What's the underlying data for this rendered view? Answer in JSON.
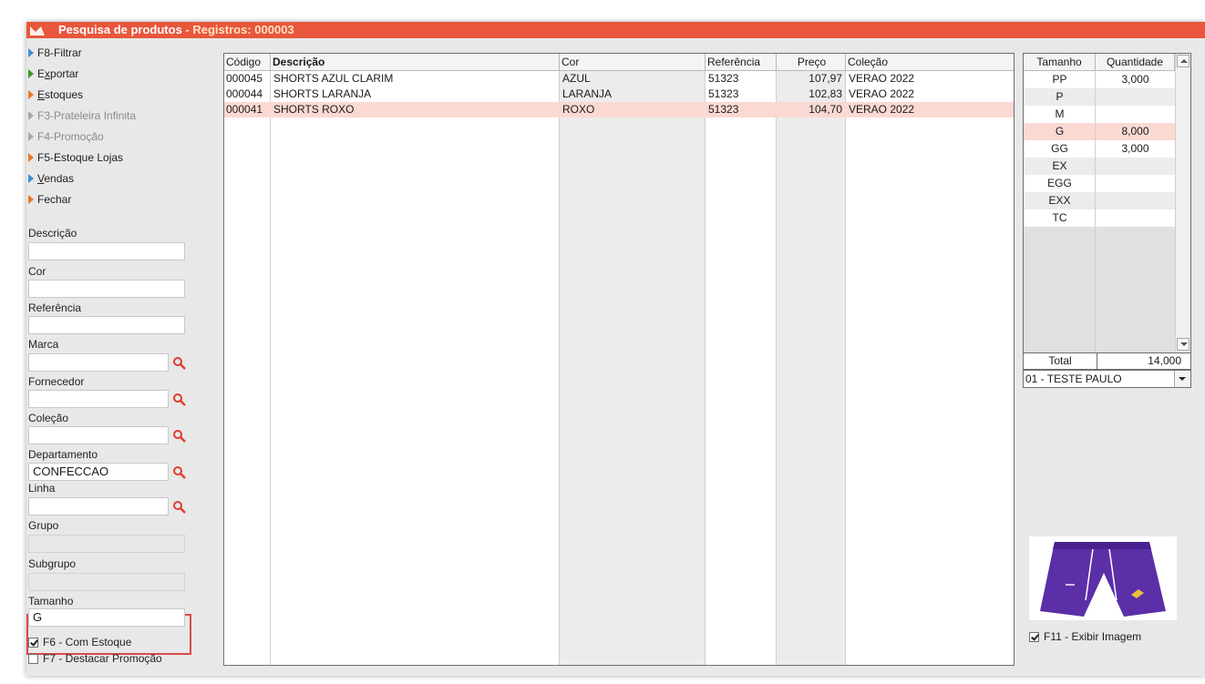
{
  "title": {
    "name": "Pesquisa de produtos",
    "separator": " - ",
    "records": "Registros: 000003"
  },
  "menu": [
    {
      "key": "",
      "label": "F8-Filtrar",
      "color": "blue",
      "enabled": true
    },
    {
      "key": "E",
      "label": "xportar",
      "color": "green",
      "enabled": true,
      "underline_index": 1
    },
    {
      "key": "E",
      "label": "stoques",
      "color": "orange",
      "enabled": true
    },
    {
      "key": "",
      "label": "F3-Prateleira Infinita",
      "color": "grey",
      "enabled": false
    },
    {
      "key": "",
      "label": "F4-Promoção",
      "color": "grey",
      "enabled": false
    },
    {
      "key": "",
      "label": "F5-Estoque Lojas",
      "color": "orange",
      "enabled": true
    },
    {
      "key": "V",
      "label": "endas",
      "color": "blue",
      "enabled": true
    },
    {
      "key": "",
      "label": "Fechar",
      "color": "orange",
      "enabled": true
    }
  ],
  "filters": {
    "descricao": {
      "label": "Descrição",
      "value": ""
    },
    "cor": {
      "label": "Cor",
      "value": ""
    },
    "referencia": {
      "label": "Referência",
      "value": ""
    },
    "marca": {
      "label": "Marca",
      "value": ""
    },
    "fornecedor": {
      "label": "Fornecedor",
      "value": ""
    },
    "colecao": {
      "label": "Coleção",
      "value": ""
    },
    "departamento": {
      "label": "Departamento",
      "value": "CONFECCAO"
    },
    "linha": {
      "label": "Linha",
      "value": ""
    },
    "grupo": {
      "label": "Grupo",
      "value": ""
    },
    "subgrupo": {
      "label": "Subgrupo",
      "value": ""
    },
    "tamanho": {
      "label": "Tamanho",
      "value": "G"
    }
  },
  "checks": {
    "com_estoque": {
      "label": "F6 - Com Estoque",
      "checked": true
    },
    "destacar_promocao": {
      "label": "F7 - Destacar Promoção",
      "checked": false
    }
  },
  "grid": {
    "columns": [
      "Código",
      "Descrição",
      "Cor",
      "Referência",
      "Preço",
      "Coleção"
    ],
    "rows": [
      {
        "codigo": "000045",
        "descricao": "SHORTS AZUL CLARIM",
        "cor": "AZUL",
        "referencia": "51323",
        "preco": "107,97",
        "colecao": "VERAO 2022",
        "selected": false
      },
      {
        "codigo": "000044",
        "descricao": "SHORTS LARANJA",
        "cor": "LARANJA",
        "referencia": "51323",
        "preco": "102,83",
        "colecao": "VERAO 2022",
        "selected": false
      },
      {
        "codigo": "000041",
        "descricao": "SHORTS ROXO",
        "cor": "ROXO",
        "referencia": "51323",
        "preco": "104,70",
        "colecao": "VERAO 2022",
        "selected": true
      }
    ]
  },
  "sizes": {
    "columns": [
      "Tamanho",
      "Quantidade"
    ],
    "rows": [
      {
        "tamanho": "PP",
        "quantidade": "3,000",
        "selected": false
      },
      {
        "tamanho": "P",
        "quantidade": "",
        "selected": false
      },
      {
        "tamanho": "M",
        "quantidade": "",
        "selected": false
      },
      {
        "tamanho": "G",
        "quantidade": "8,000",
        "selected": true
      },
      {
        "tamanho": "GG",
        "quantidade": "3,000",
        "selected": false
      },
      {
        "tamanho": "EX",
        "quantidade": "",
        "selected": false
      },
      {
        "tamanho": "EGG",
        "quantidade": "",
        "selected": false
      },
      {
        "tamanho": "EXX",
        "quantidade": "",
        "selected": false
      },
      {
        "tamanho": "TC",
        "quantidade": "",
        "selected": false
      }
    ],
    "total_label": "Total",
    "total_value": "14,000"
  },
  "store_select": {
    "value": "01 - TESTE PAULO"
  },
  "image_toggle": {
    "label": "F11 - Exibir Imagem",
    "checked": true
  },
  "colors": {
    "titlebar": "#e8563c",
    "selection": "#fbd9d3",
    "highlight_border": "#d94a4a",
    "product": "#5a2fa8"
  }
}
